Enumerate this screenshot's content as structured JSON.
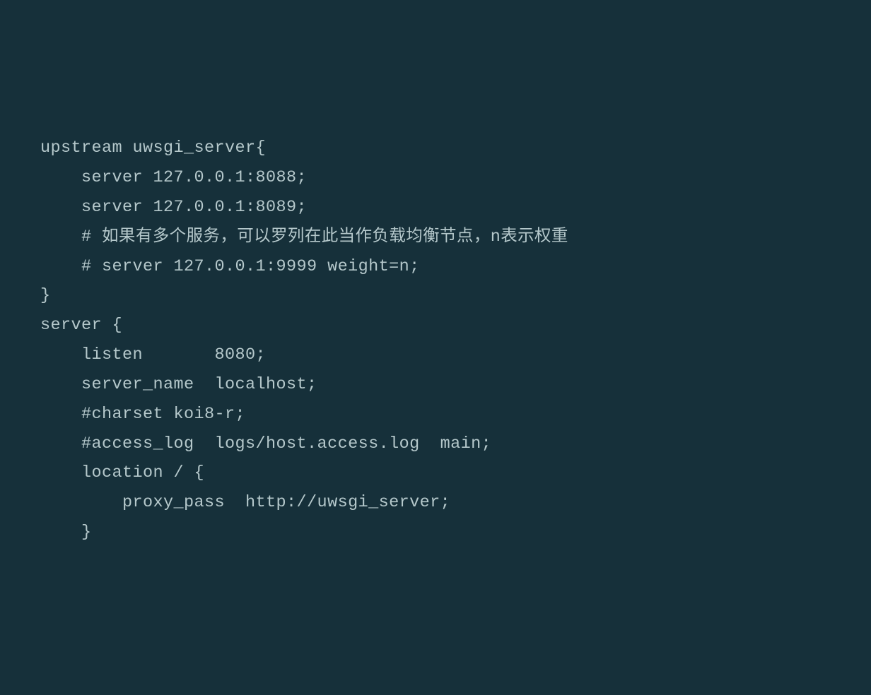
{
  "code": {
    "lines": [
      "upstream uwsgi_server{",
      "    server 127.0.0.1:8088;",
      "    server 127.0.0.1:8089;",
      "    # 如果有多个服务，可以罗列在此当作负载均衡节点，n表示权重",
      "    # server 127.0.0.1:9999 weight=n;",
      "}",
      "",
      "",
      "server {",
      "    listen       8080;",
      "    server_name  localhost;",
      "",
      "    #charset koi8-r;",
      "",
      "    #access_log  logs/host.access.log  main;",
      "",
      "    location / {",
      "        proxy_pass  http://uwsgi_server;",
      "    }"
    ]
  }
}
